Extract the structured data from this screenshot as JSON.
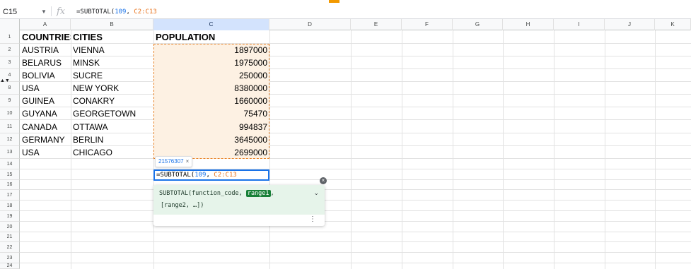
{
  "formula_bar": {
    "cell_ref": "C15",
    "fx_label": "fx",
    "formula_prefix": "=SUBTOTAL(",
    "formula_code": "109",
    "formula_sep": ", ",
    "formula_range": "C2:C13"
  },
  "columns": [
    "A",
    "B",
    "C",
    "D",
    "E",
    "F",
    "G",
    "H",
    "I",
    "J",
    "K"
  ],
  "rows": [
    "1",
    "2",
    "3",
    "4",
    "8",
    "9",
    "10",
    "11",
    "12",
    "13",
    "14",
    "15",
    "16",
    "17",
    "18",
    "19",
    "20",
    "21",
    "22",
    "23",
    "24"
  ],
  "headers": {
    "countries": "COUNTRIES",
    "cities": "CITIES",
    "population": "POPULATION"
  },
  "table": [
    {
      "country": "AUSTRIA",
      "city": "VIENNA",
      "population": "1897000"
    },
    {
      "country": "BELARUS",
      "city": "MINSK",
      "population": "1975000"
    },
    {
      "country": "BOLIVIA",
      "city": "SUCRE",
      "population": "250000"
    },
    {
      "country": "USA",
      "city": "NEW YORK",
      "population": "8380000"
    },
    {
      "country": "GUINEA",
      "city": "CONAKRY",
      "population": "1660000"
    },
    {
      "country": "GUYANA",
      "city": "GEORGETOWN",
      "population": "75470"
    },
    {
      "country": "CANADA",
      "city": "OTTAWA",
      "population": "994837"
    },
    {
      "country": "GERMANY",
      "city": "BERLIN",
      "population": "3645000"
    },
    {
      "country": "USA",
      "city": "CHICAGO",
      "population": "2699000"
    }
  ],
  "preview": {
    "value": "21576307",
    "close": "×"
  },
  "help": {
    "fn_name": "SUBTOTAL(",
    "arg1": "function_code, ",
    "arg2": "range1",
    "arg_sep": ",",
    "arg3": "[range2, …])",
    "chevron": "⌄",
    "more": "⋮",
    "close": "×"
  },
  "hidden_rows_marker": "▲▼",
  "colors": {
    "accent": "#1a73e8",
    "range": "#e8852b",
    "help_bg": "#e6f4ea",
    "arg_highlight": "#188038"
  }
}
